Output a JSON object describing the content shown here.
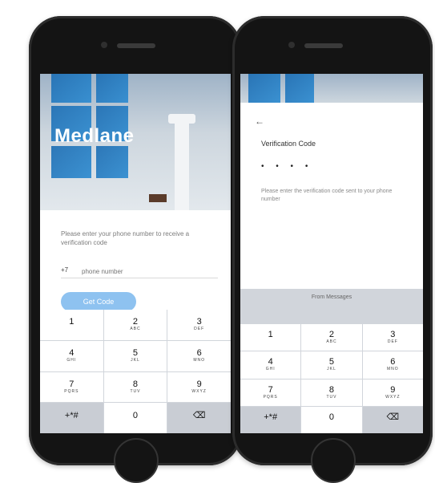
{
  "left_screen": {
    "brand_title": "Medlane",
    "brand_subtitle": "",
    "login_prompt": "Please enter your phone number to receive a verification code",
    "phone_prefix": "+7",
    "phone_placeholder": "phone number",
    "send_button_label": "Get Code"
  },
  "right_screen": {
    "back_label": "←",
    "verify_title": "Verification Code",
    "code_dots": "• • • •",
    "verify_hint": "Please enter the verification code sent to your phone number",
    "keyboard_suggestion": "From Messages"
  },
  "keypad": {
    "keys": [
      {
        "num": "1",
        "letters": ""
      },
      {
        "num": "2",
        "letters": "ABC"
      },
      {
        "num": "3",
        "letters": "DEF"
      },
      {
        "num": "4",
        "letters": "GHI"
      },
      {
        "num": "5",
        "letters": "JKL"
      },
      {
        "num": "6",
        "letters": "MNO"
      },
      {
        "num": "7",
        "letters": "PQRS"
      },
      {
        "num": "8",
        "letters": "TUV"
      },
      {
        "num": "9",
        "letters": "WXYZ"
      },
      {
        "num": "+*#",
        "letters": ""
      },
      {
        "num": "0",
        "letters": ""
      },
      {
        "num": "⌫",
        "letters": ""
      }
    ]
  },
  "colors": {
    "accent": "#8ec2f0",
    "hero_blue": "#1f6fb4",
    "phone_body": "#141414"
  }
}
